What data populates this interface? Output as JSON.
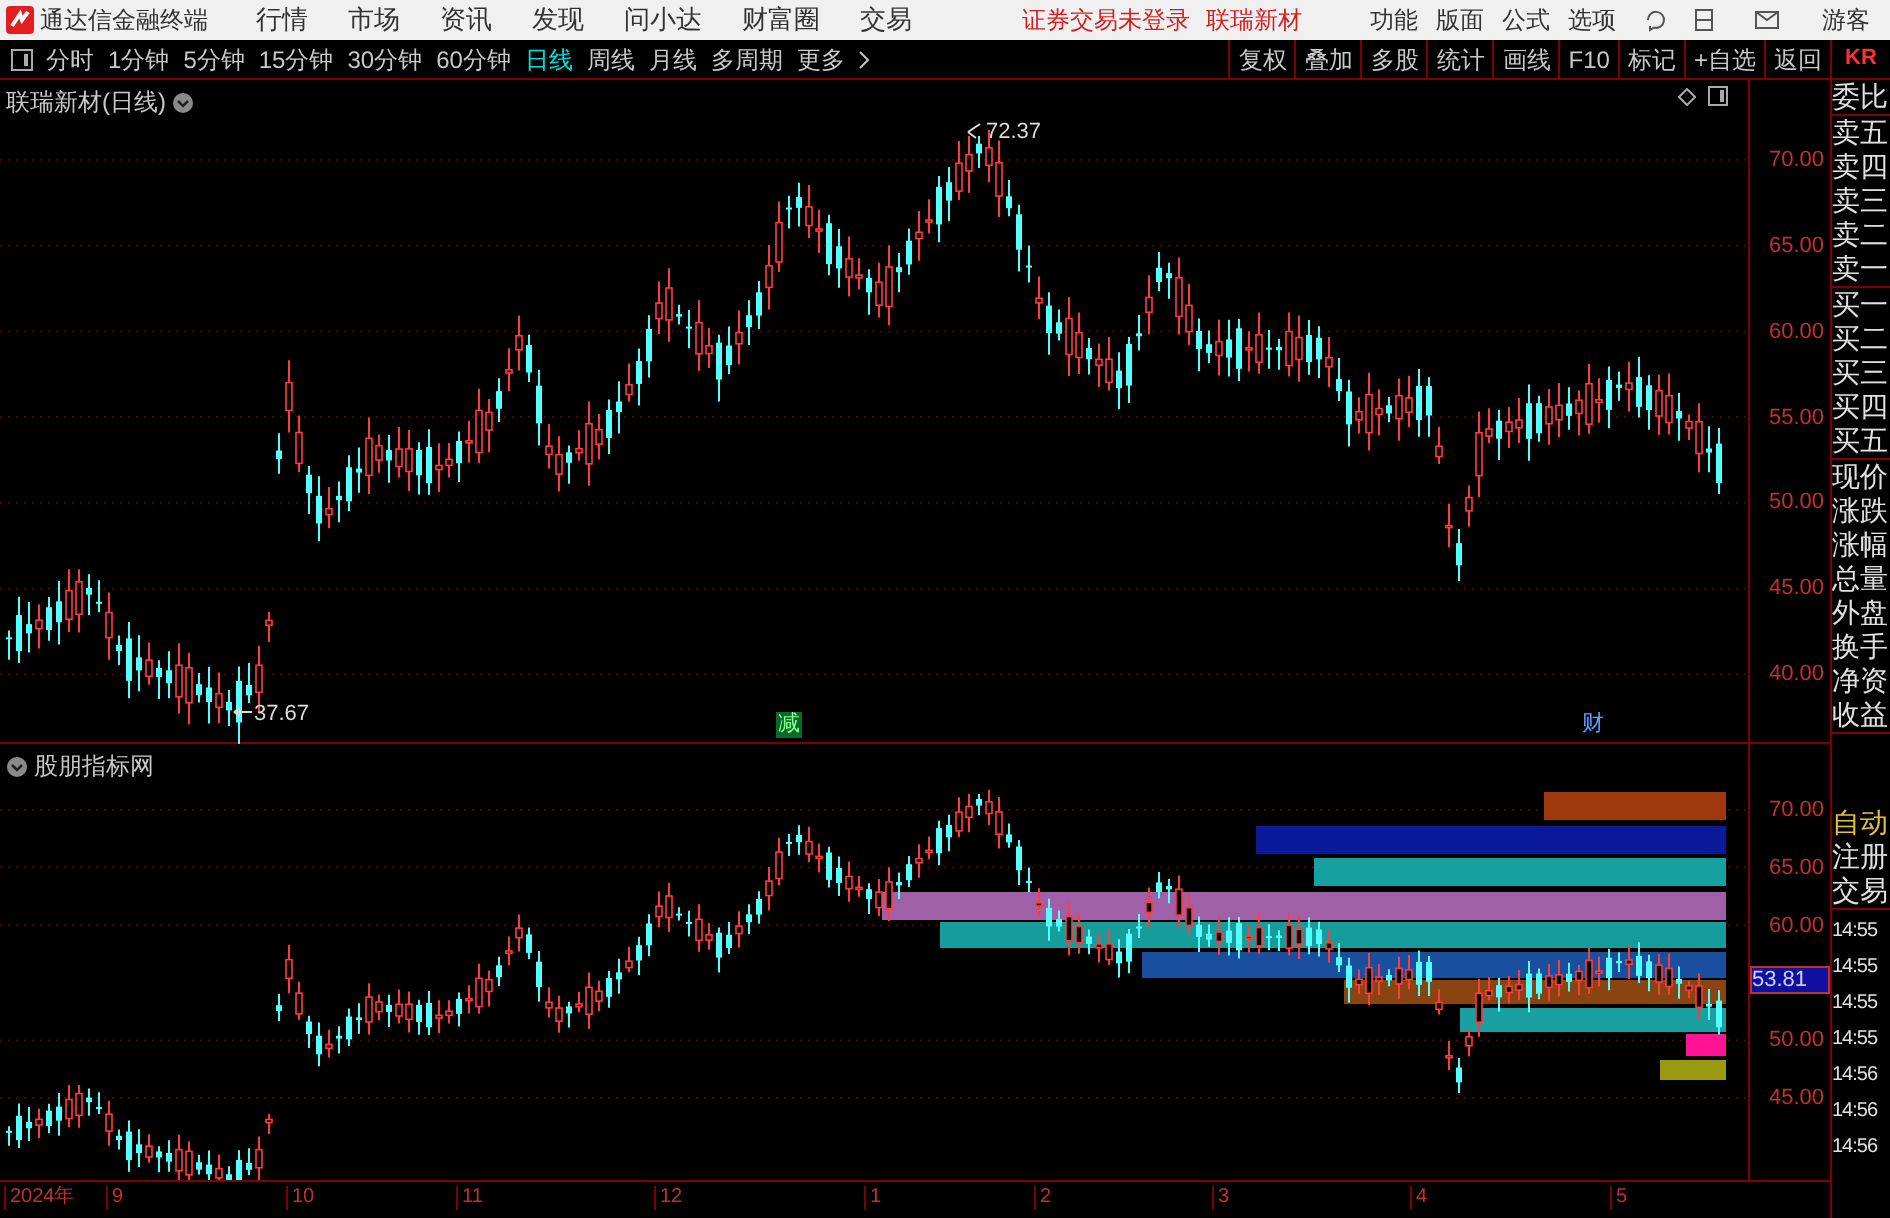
{
  "title_bar": {
    "app_name": "通达信金融终端",
    "menu": [
      "行情",
      "市场",
      "资讯",
      "发现",
      "问小达",
      "财富圈",
      "交易"
    ],
    "status": "证券交易未登录",
    "stock": "联瑞新材",
    "tools": [
      "功能",
      "版面",
      "公式",
      "选项"
    ],
    "user": "游客"
  },
  "periods": [
    {
      "label": "分时",
      "selected": false
    },
    {
      "label": "1分钟",
      "selected": false
    },
    {
      "label": "5分钟",
      "selected": false
    },
    {
      "label": "15分钟",
      "selected": false
    },
    {
      "label": "30分钟",
      "selected": false
    },
    {
      "label": "60分钟",
      "selected": false
    },
    {
      "label": "日线",
      "selected": true
    },
    {
      "label": "周线",
      "selected": false
    },
    {
      "label": "月线",
      "selected": false
    },
    {
      "label": "多周期",
      "selected": false
    },
    {
      "label": "更多",
      "selected": false
    }
  ],
  "actions": [
    "复权",
    "叠加",
    "多股",
    "统计",
    "画线",
    "F10",
    "标记",
    "+自选",
    "返回"
  ],
  "main_chart": {
    "title": "联瑞新材(日线)",
    "high_label": "72.37",
    "low_label": "37.67",
    "markers": [
      {
        "text": "减",
        "kind": "boxed"
      },
      {
        "text": "财",
        "kind": "plain"
      }
    ],
    "price_ticks": [
      "70.00",
      "65.00",
      "60.00",
      "55.00",
      "50.00",
      "45.00",
      "40.00"
    ]
  },
  "indicator": {
    "title": "股朋指标网",
    "price_ticks": [
      "70.00",
      "65.00",
      "60.00",
      "50.00",
      "45.00"
    ],
    "current_price": "53.81",
    "bars": [
      {
        "color": "#a0380e"
      },
      {
        "color": "#0a1a9a"
      },
      {
        "color": "#17a0a0"
      },
      {
        "color": "#a060a8"
      },
      {
        "color": "#179c9c"
      },
      {
        "color": "#1a4fa0"
      },
      {
        "color": "#8a4412"
      },
      {
        "color": "#1aa0a0"
      },
      {
        "color": "#ff1493"
      },
      {
        "color": "#9a9a10"
      }
    ]
  },
  "time_axis": [
    "2024年",
    "9",
    "10",
    "11",
    "12",
    "1",
    "2",
    "3",
    "4",
    "5"
  ],
  "quote_panel": {
    "code": "KR",
    "groups": [
      [
        "委比"
      ],
      [
        "卖五",
        "卖四",
        "卖三",
        "卖二",
        "卖一"
      ],
      [
        "买一",
        "买二",
        "买三",
        "买四",
        "买五"
      ],
      [
        "现价",
        "涨跌",
        "涨幅",
        "总量",
        "外盘",
        "换手",
        "净资",
        "收益"
      ]
    ],
    "buttons": [
      {
        "label": "自动",
        "selected": true
      },
      {
        "label": "注册",
        "selected": false
      },
      {
        "label": "交易",
        "selected": false
      }
    ],
    "times": [
      "14:55",
      "14:55",
      "14:55",
      "14:55",
      "14:56",
      "14:56",
      "14:56"
    ]
  }
}
